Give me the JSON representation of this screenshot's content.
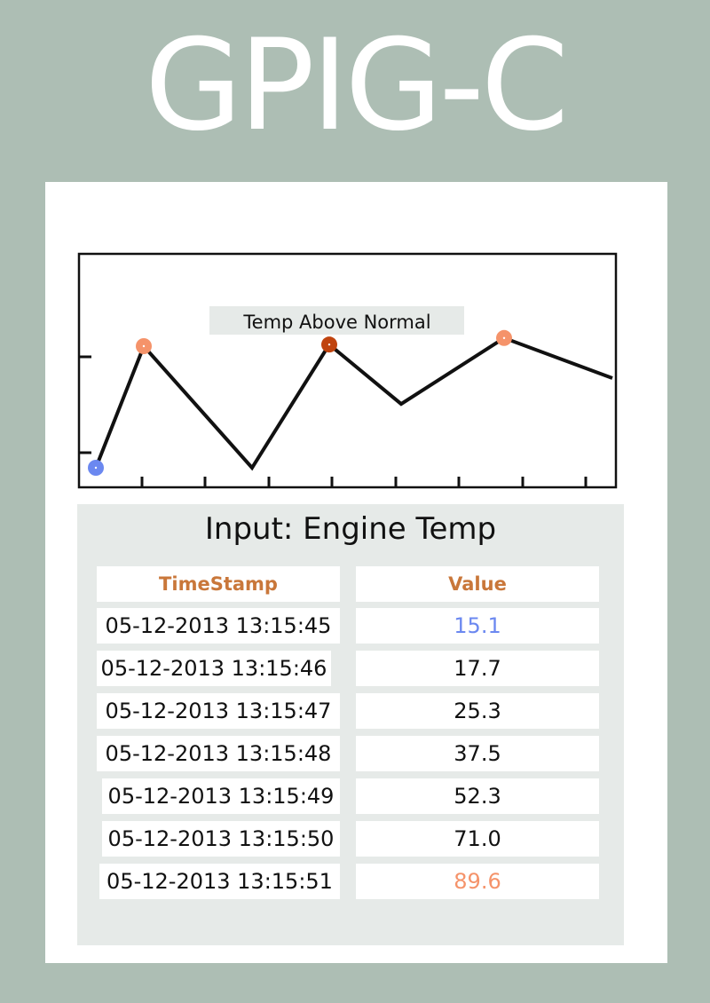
{
  "header": {
    "title": "GPIG-C"
  },
  "chart_data": {
    "type": "line",
    "annotation": "Temp Above Normal",
    "x": [
      1,
      2,
      3,
      4,
      5,
      6,
      7,
      8,
      9
    ],
    "values": [
      15.1,
      89.6,
      15.1,
      90.6,
      54.2,
      94.6,
      70.0
    ],
    "markers": [
      {
        "point": 0,
        "color": "#6b88f0"
      },
      {
        "point": 1,
        "color": "#f5936a"
      },
      {
        "point": 3,
        "color": "#c0440f"
      },
      {
        "point": 5,
        "color": "#f5936a"
      }
    ],
    "line_color": "#111111",
    "annotation_bg": "#e6eae8"
  },
  "table": {
    "title": "Input: Engine Temp",
    "columns": [
      "TimeStamp",
      "Value"
    ],
    "rows": [
      {
        "timestamp": "05-12-2013 13:15:45",
        "value": "15.1",
        "value_color": "#6b88f0"
      },
      {
        "timestamp": "05-12-2013 13:15:46",
        "value": "17.7",
        "value_color": "#111111"
      },
      {
        "timestamp": "05-12-2013 13:15:47",
        "value": "25.3",
        "value_color": "#111111"
      },
      {
        "timestamp": "05-12-2013 13:15:48",
        "value": "37.5",
        "value_color": "#111111"
      },
      {
        "timestamp": "05-12-2013 13:15:49",
        "value": "52.3",
        "value_color": "#111111"
      },
      {
        "timestamp": "05-12-2013 13:15:50",
        "value": "71.0",
        "value_color": "#111111"
      },
      {
        "timestamp": "05-12-2013 13:15:51",
        "value": "89.6",
        "value_color": "#f5936a"
      }
    ]
  },
  "colors": {
    "background": "#adbeb4",
    "header_text": "#c9773a"
  }
}
